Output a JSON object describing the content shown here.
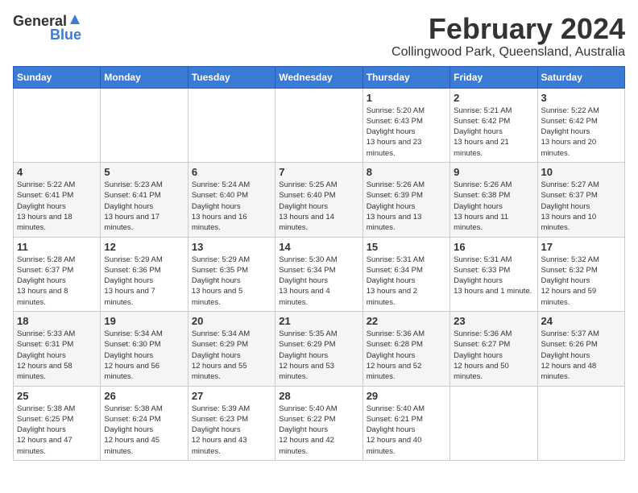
{
  "logo": {
    "text_general": "General",
    "text_blue": "Blue"
  },
  "header": {
    "title": "February 2024",
    "subtitle": "Collingwood Park, Queensland, Australia"
  },
  "weekdays": [
    "Sunday",
    "Monday",
    "Tuesday",
    "Wednesday",
    "Thursday",
    "Friday",
    "Saturday"
  ],
  "weeks": [
    [
      {
        "day": "",
        "sunrise": "",
        "sunset": "",
        "daylight": "",
        "empty": true
      },
      {
        "day": "",
        "sunrise": "",
        "sunset": "",
        "daylight": "",
        "empty": true
      },
      {
        "day": "",
        "sunrise": "",
        "sunset": "",
        "daylight": "",
        "empty": true
      },
      {
        "day": "",
        "sunrise": "",
        "sunset": "",
        "daylight": "",
        "empty": true
      },
      {
        "day": "1",
        "sunrise": "5:20 AM",
        "sunset": "6:43 PM",
        "daylight": "13 hours and 23 minutes."
      },
      {
        "day": "2",
        "sunrise": "5:21 AM",
        "sunset": "6:42 PM",
        "daylight": "13 hours and 21 minutes."
      },
      {
        "day": "3",
        "sunrise": "5:22 AM",
        "sunset": "6:42 PM",
        "daylight": "13 hours and 20 minutes."
      }
    ],
    [
      {
        "day": "4",
        "sunrise": "5:22 AM",
        "sunset": "6:41 PM",
        "daylight": "13 hours and 18 minutes."
      },
      {
        "day": "5",
        "sunrise": "5:23 AM",
        "sunset": "6:41 PM",
        "daylight": "13 hours and 17 minutes."
      },
      {
        "day": "6",
        "sunrise": "5:24 AM",
        "sunset": "6:40 PM",
        "daylight": "13 hours and 16 minutes."
      },
      {
        "day": "7",
        "sunrise": "5:25 AM",
        "sunset": "6:40 PM",
        "daylight": "13 hours and 14 minutes."
      },
      {
        "day": "8",
        "sunrise": "5:26 AM",
        "sunset": "6:39 PM",
        "daylight": "13 hours and 13 minutes."
      },
      {
        "day": "9",
        "sunrise": "5:26 AM",
        "sunset": "6:38 PM",
        "daylight": "13 hours and 11 minutes."
      },
      {
        "day": "10",
        "sunrise": "5:27 AM",
        "sunset": "6:37 PM",
        "daylight": "13 hours and 10 minutes."
      }
    ],
    [
      {
        "day": "11",
        "sunrise": "5:28 AM",
        "sunset": "6:37 PM",
        "daylight": "13 hours and 8 minutes."
      },
      {
        "day": "12",
        "sunrise": "5:29 AM",
        "sunset": "6:36 PM",
        "daylight": "13 hours and 7 minutes."
      },
      {
        "day": "13",
        "sunrise": "5:29 AM",
        "sunset": "6:35 PM",
        "daylight": "13 hours and 5 minutes."
      },
      {
        "day": "14",
        "sunrise": "5:30 AM",
        "sunset": "6:34 PM",
        "daylight": "13 hours and 4 minutes."
      },
      {
        "day": "15",
        "sunrise": "5:31 AM",
        "sunset": "6:34 PM",
        "daylight": "13 hours and 2 minutes."
      },
      {
        "day": "16",
        "sunrise": "5:31 AM",
        "sunset": "6:33 PM",
        "daylight": "13 hours and 1 minute."
      },
      {
        "day": "17",
        "sunrise": "5:32 AM",
        "sunset": "6:32 PM",
        "daylight": "12 hours and 59 minutes."
      }
    ],
    [
      {
        "day": "18",
        "sunrise": "5:33 AM",
        "sunset": "6:31 PM",
        "daylight": "12 hours and 58 minutes."
      },
      {
        "day": "19",
        "sunrise": "5:34 AM",
        "sunset": "6:30 PM",
        "daylight": "12 hours and 56 minutes."
      },
      {
        "day": "20",
        "sunrise": "5:34 AM",
        "sunset": "6:29 PM",
        "daylight": "12 hours and 55 minutes."
      },
      {
        "day": "21",
        "sunrise": "5:35 AM",
        "sunset": "6:29 PM",
        "daylight": "12 hours and 53 minutes."
      },
      {
        "day": "22",
        "sunrise": "5:36 AM",
        "sunset": "6:28 PM",
        "daylight": "12 hours and 52 minutes."
      },
      {
        "day": "23",
        "sunrise": "5:36 AM",
        "sunset": "6:27 PM",
        "daylight": "12 hours and 50 minutes."
      },
      {
        "day": "24",
        "sunrise": "5:37 AM",
        "sunset": "6:26 PM",
        "daylight": "12 hours and 48 minutes."
      }
    ],
    [
      {
        "day": "25",
        "sunrise": "5:38 AM",
        "sunset": "6:25 PM",
        "daylight": "12 hours and 47 minutes."
      },
      {
        "day": "26",
        "sunrise": "5:38 AM",
        "sunset": "6:24 PM",
        "daylight": "12 hours and 45 minutes."
      },
      {
        "day": "27",
        "sunrise": "5:39 AM",
        "sunset": "6:23 PM",
        "daylight": "12 hours and 43 minutes."
      },
      {
        "day": "28",
        "sunrise": "5:40 AM",
        "sunset": "6:22 PM",
        "daylight": "12 hours and 42 minutes."
      },
      {
        "day": "29",
        "sunrise": "5:40 AM",
        "sunset": "6:21 PM",
        "daylight": "12 hours and 40 minutes."
      },
      {
        "day": "",
        "sunrise": "",
        "sunset": "",
        "daylight": "",
        "empty": true
      },
      {
        "day": "",
        "sunrise": "",
        "sunset": "",
        "daylight": "",
        "empty": true
      }
    ]
  ]
}
